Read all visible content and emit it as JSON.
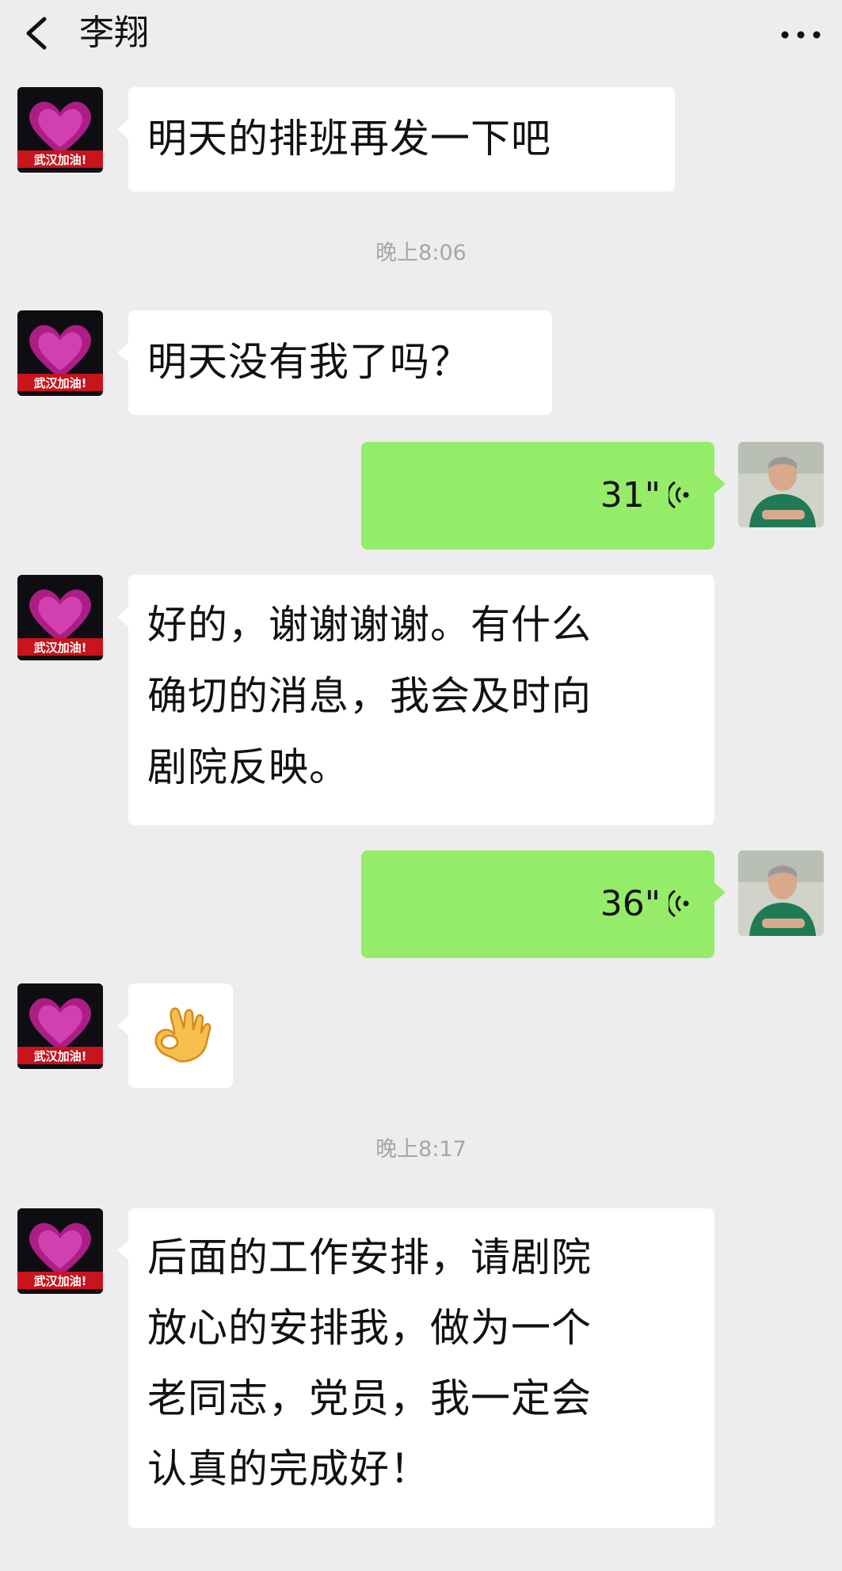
{
  "chat": {
    "contact_name": "李翔",
    "back_icon": "chevron-left-icon",
    "more_icon": "ellipsis-icon"
  },
  "avatars": {
    "contact": {
      "label": "武汉加油!",
      "heart_color": "#c8219a"
    },
    "self": {
      "shirt_color": "#1f7a55"
    }
  },
  "messages": [
    {
      "side": "in",
      "type": "text",
      "text": "明天的排班再发一下吧"
    },
    {
      "type": "timestamp",
      "text": "晚上8:06"
    },
    {
      "side": "in",
      "type": "text",
      "text": "明天没有我了吗？"
    },
    {
      "side": "out",
      "type": "voice",
      "duration": "31\"",
      "icon": "voice-wave-icon"
    },
    {
      "side": "in",
      "type": "text",
      "text": "好的，谢谢谢谢。有什么\n确切的消息，我会及时向\n剧院反映。"
    },
    {
      "side": "out",
      "type": "voice",
      "duration": "36\"",
      "icon": "voice-wave-icon"
    },
    {
      "side": "in",
      "type": "emoji",
      "icon": "ok-hand-icon"
    },
    {
      "type": "timestamp",
      "text": "晚上8:17"
    },
    {
      "side": "in",
      "type": "text",
      "text": "后面的工作安排，请剧院\n放心的安排我，做为一个\n老同志，党员，我一定会\n认真的完成好！"
    }
  ],
  "colors": {
    "background": "#ededed",
    "incoming_bubble": "#ffffff",
    "outgoing_bubble": "#95ec69",
    "timestamp": "#a6a6a6"
  }
}
